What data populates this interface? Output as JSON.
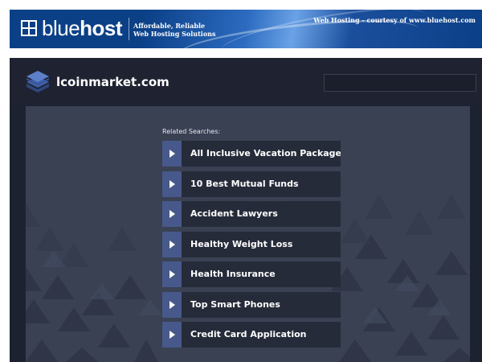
{
  "banner": {
    "brand_light": "blue",
    "brand_bold": "host",
    "tagline_line1": "Affordable, Reliable",
    "tagline_line2": "Web Hosting Solutions",
    "courtesy": "Web Hosting - courtesy of www.bluehost.com",
    "logo_icon": "grid-square-icon",
    "color": "#0b3f86"
  },
  "site": {
    "title": "lcoinmarket.com",
    "logo_icon": "stacked-layers-icon",
    "search_value": "",
    "related_label": "Related Searches:",
    "links": [
      {
        "label": "All Inclusive Vacation Packages"
      },
      {
        "label": "10 Best Mutual Funds"
      },
      {
        "label": "Accident Lawyers"
      },
      {
        "label": "Healthy Weight Loss"
      },
      {
        "label": "Health Insurance"
      },
      {
        "label": "Top Smart Phones"
      },
      {
        "label": "Credit Card Application"
      }
    ],
    "colors": {
      "header_bg": "#1f2331",
      "content_bg": "#3a4153",
      "arrow_bg": "#47598a",
      "link_bg": "#262b3a"
    }
  }
}
